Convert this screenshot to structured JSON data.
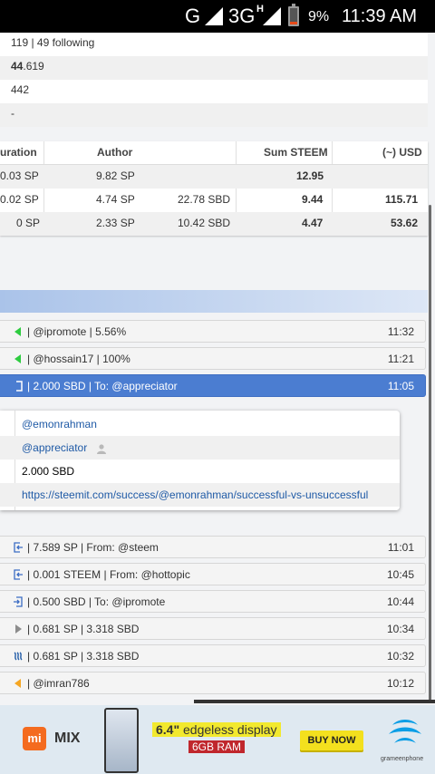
{
  "status_bar": {
    "network_g": "G",
    "network_3g": "3G",
    "network_h": "H",
    "battery": "9%",
    "battery_level": 0.09,
    "time": "11:39 AM"
  },
  "profile_info": {
    "rows": [
      "119 | 49 following",
      "44.619",
      "442",
      "-"
    ],
    "reputation_bold": "44",
    "reputation_rest": ".619"
  },
  "payout_table": {
    "headers": {
      "duration": "uration",
      "author": "Author",
      "sum_steem": "Sum STEEM",
      "usd": "(~) USD"
    },
    "rows": [
      {
        "duration": "0.03 SP",
        "author": "9.82 SP",
        "sbd": "",
        "sum_steem": "12.95",
        "usd": ""
      },
      {
        "duration": "0.02 SP",
        "author": "4.74 SP",
        "sbd": "22.78 SBD",
        "sum_steem": "9.44",
        "usd": "115.71"
      },
      {
        "duration": "0 SP",
        "author": "2.33 SP",
        "sbd": "10.42 SBD",
        "sum_steem": "4.47",
        "usd": "53.62"
      }
    ]
  },
  "transactions": [
    {
      "icon": "green-arrow-left-icon",
      "label": "| @ipromote | 5.56%",
      "time": "11:32"
    },
    {
      "icon": "green-arrow-left-icon",
      "label": "| @hossain17 | 100%",
      "time": "11:21"
    },
    {
      "icon": "transfer-out-icon",
      "label": "| 2.000 SBD | To: @appreciator",
      "time": "11:05"
    },
    {
      "icon": "receive-in-icon",
      "label": "| 7.589 SP | From: @steem",
      "time": "11:01"
    },
    {
      "icon": "receive-in-icon",
      "label": "| 0.001 STEEM | From: @hottopic",
      "time": "10:45"
    },
    {
      "icon": "transfer-out-icon",
      "label": "| 0.500 SBD | To: @ipromote",
      "time": "10:44"
    },
    {
      "icon": "gray-play-icon",
      "label": "| 0.681 SP | 3.318 SBD",
      "time": "10:34"
    },
    {
      "icon": "steem-logo-icon",
      "label": "| 0.681 SP | 3.318 SBD",
      "time": "10:32"
    },
    {
      "icon": "orange-arrow-left-icon",
      "label": "| @imran786",
      "time": "10:12"
    }
  ],
  "transfer_detail": {
    "from": "@emonrahman",
    "to": "@appreciator",
    "amount": "2.000 SBD",
    "memo": "https://steemit.com/success/@emonrahman/successful-vs-unsuccessful"
  },
  "ad": {
    "brand_mi": "mi",
    "brand_mix": "MIX",
    "display_size": "6.4\"",
    "display_text": " edgeless display",
    "ram": "6GB RAM",
    "cta": "BUY NOW",
    "operator": "grameenphone"
  },
  "colors": {
    "selected_row": "#4b7dd1",
    "link": "#1f5aa6",
    "vote_green": "#2ecc40",
    "vote_orange": "#f5a623",
    "ad_yellow": "#f3e01e"
  }
}
